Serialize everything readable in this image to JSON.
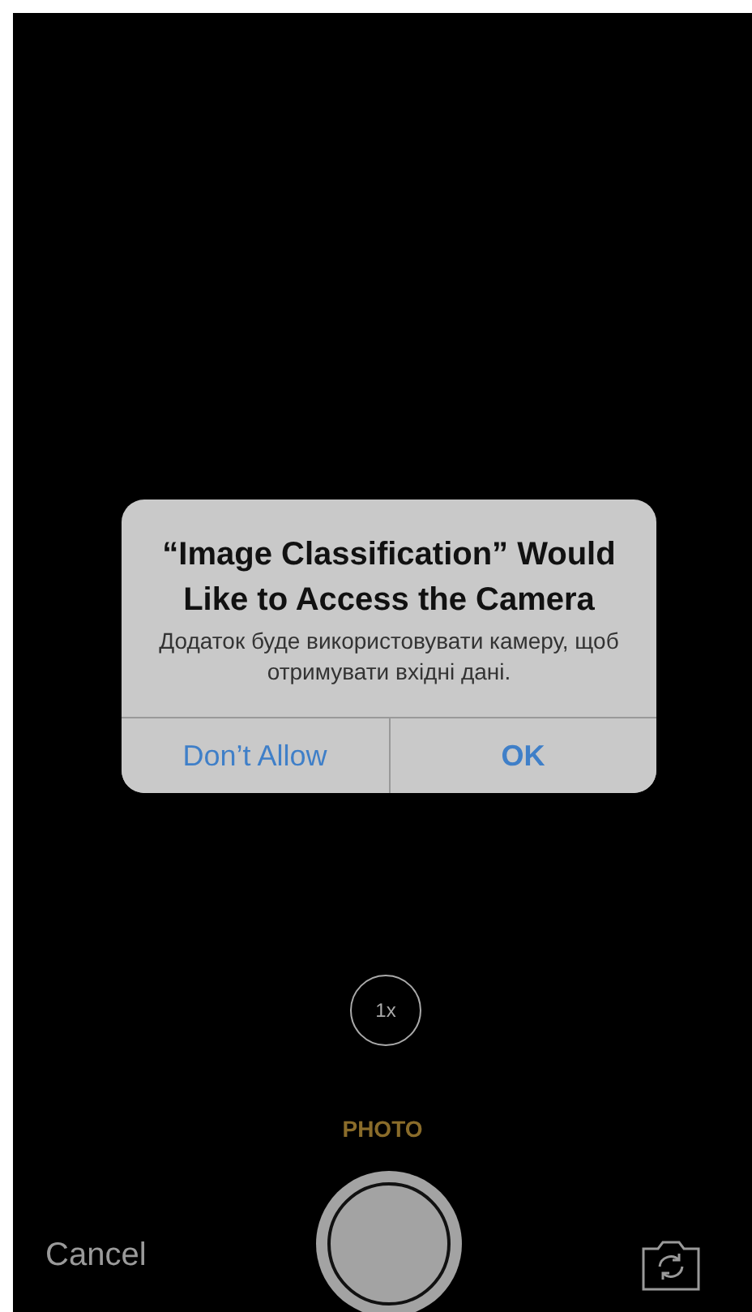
{
  "alert": {
    "title": "“Image Classification” Would Like to Access the Camera",
    "message": "Додаток буде використовувати камеру, щоб отримувати вхідні дані.",
    "buttons": [
      {
        "label": "Don’t Allow",
        "kind": "normal"
      },
      {
        "label": "OK",
        "kind": "default"
      }
    ]
  },
  "camera": {
    "zoom": "1x",
    "mode": "PHOTO",
    "cancel": "Cancel"
  }
}
